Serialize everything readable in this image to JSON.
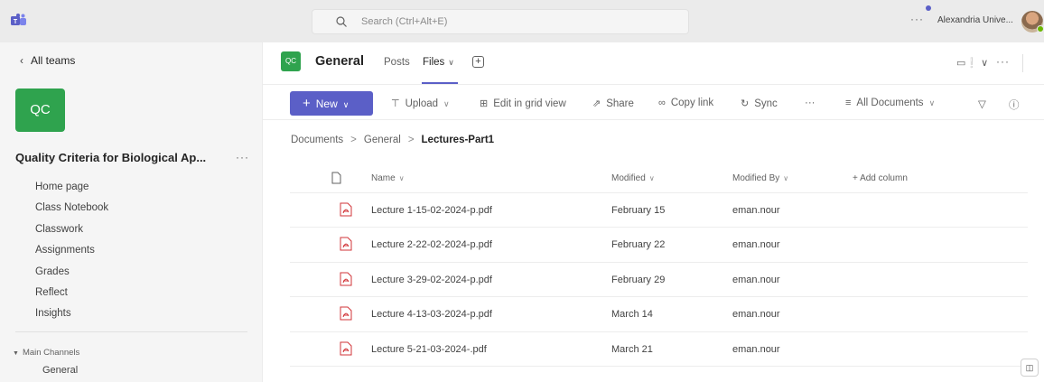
{
  "topbar": {
    "search_placeholder": "Search (Ctrl+Alt+E)",
    "more": "···",
    "org_name": "Alexandria Unive..."
  },
  "sidebar": {
    "back_label": "All teams",
    "team_initials": "QC",
    "team_name": "Quality Criteria for Biological Ap...",
    "team_more": "···",
    "nav": [
      {
        "label": "Home page"
      },
      {
        "label": "Class Notebook"
      },
      {
        "label": "Classwork"
      },
      {
        "label": "Assignments"
      },
      {
        "label": "Grades"
      },
      {
        "label": "Reflect"
      },
      {
        "label": "Insights"
      }
    ],
    "channels_header": "Main Channels",
    "channels": [
      {
        "label": "General"
      }
    ]
  },
  "channel": {
    "initials": "QC",
    "title": "General",
    "tabs": [
      {
        "label": "Posts"
      },
      {
        "label": "Files"
      }
    ],
    "more": "···"
  },
  "commands": {
    "new": "New",
    "upload": "Upload",
    "edit_grid": "Edit in grid view",
    "share": "Share",
    "copy_link": "Copy link",
    "sync": "Sync",
    "more": "···",
    "view": "All Documents"
  },
  "breadcrumb": {
    "items": [
      "Documents",
      "General"
    ],
    "current": "Lectures-Part1"
  },
  "table": {
    "columns": {
      "name": "Name",
      "modified": "Modified",
      "modified_by": "Modified By",
      "add_column": "+ Add column"
    },
    "rows": [
      {
        "name": "Lecture 1-15-02-2024-p.pdf",
        "modified": "February 15",
        "modified_by": "eman.nour"
      },
      {
        "name": "Lecture 2-22-02-2024-p.pdf",
        "modified": "February 22",
        "modified_by": "eman.nour"
      },
      {
        "name": "Lecture 3-29-02-2024-p.pdf",
        "modified": "February 29",
        "modified_by": "eman.nour"
      },
      {
        "name": "Lecture 4-13-03-2024-p.pdf",
        "modified": "March 14",
        "modified_by": "eman.nour"
      },
      {
        "name": "Lecture 5-21-03-2024-.pdf",
        "modified": "March 21",
        "modified_by": "eman.nour"
      }
    ]
  },
  "colors": {
    "accent": "#5b5fc7",
    "team_tile": "#2fa34e",
    "pdf_red": "#d13438"
  }
}
